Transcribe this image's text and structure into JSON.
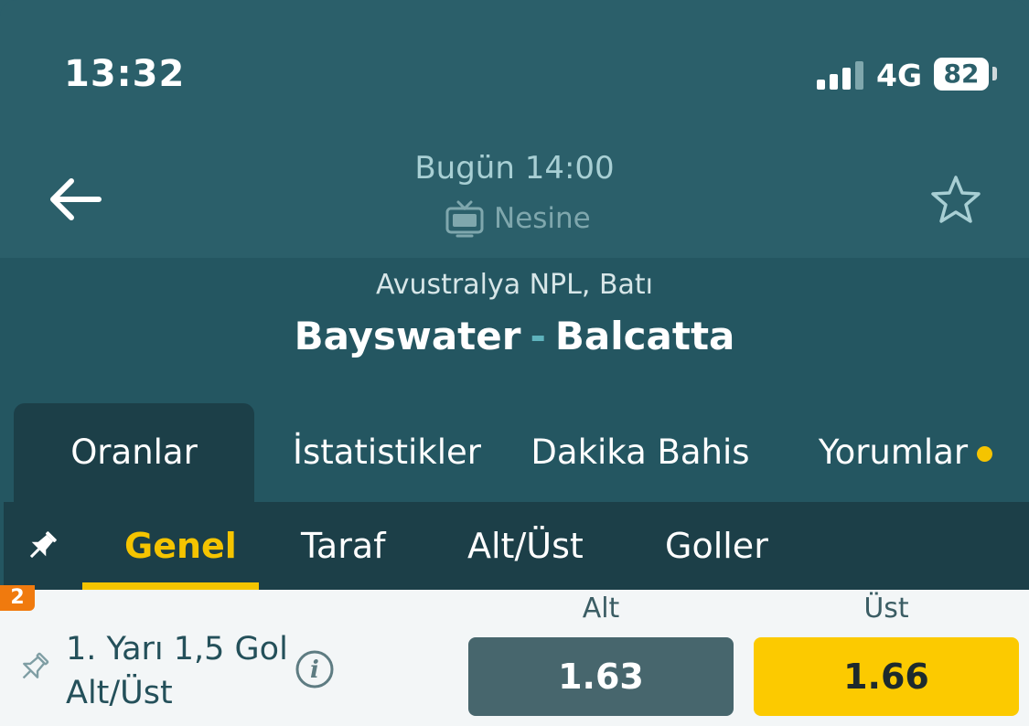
{
  "status_bar": {
    "time": "13:32",
    "network": "4G",
    "battery": "82"
  },
  "header": {
    "match_time": "Bugün 14:00",
    "broadcaster": "Nesine"
  },
  "match": {
    "league": "Avustralya NPL, Batı",
    "home_team": "Bayswater",
    "separator": "-",
    "away_team": "Balcatta"
  },
  "main_tabs": [
    {
      "label": "Oranlar",
      "active": true
    },
    {
      "label": "İstatistikler"
    },
    {
      "label": "Dakika Bahis"
    },
    {
      "label": "Yorumlar",
      "has_dot": true
    }
  ],
  "sub_tabs": [
    {
      "label": "Genel",
      "active": true
    },
    {
      "label": "Taraf"
    },
    {
      "label": "Alt/Üst"
    },
    {
      "label": "Goller"
    }
  ],
  "market": {
    "badge": "2",
    "name": "1. Yarı 1,5 Gol Alt/Üst",
    "columns": [
      {
        "label": "Alt",
        "odd": "1.63"
      },
      {
        "label": "Üst",
        "odd": "1.66"
      }
    ]
  },
  "colors": {
    "header_bg": "#2b5f6a",
    "tab_active_bg": "#1c3f48",
    "accent": "#f5c400",
    "odd_alt_bg": "#47666d",
    "odd_ust_bg": "#fcca00",
    "badge": "#f07a0e"
  }
}
